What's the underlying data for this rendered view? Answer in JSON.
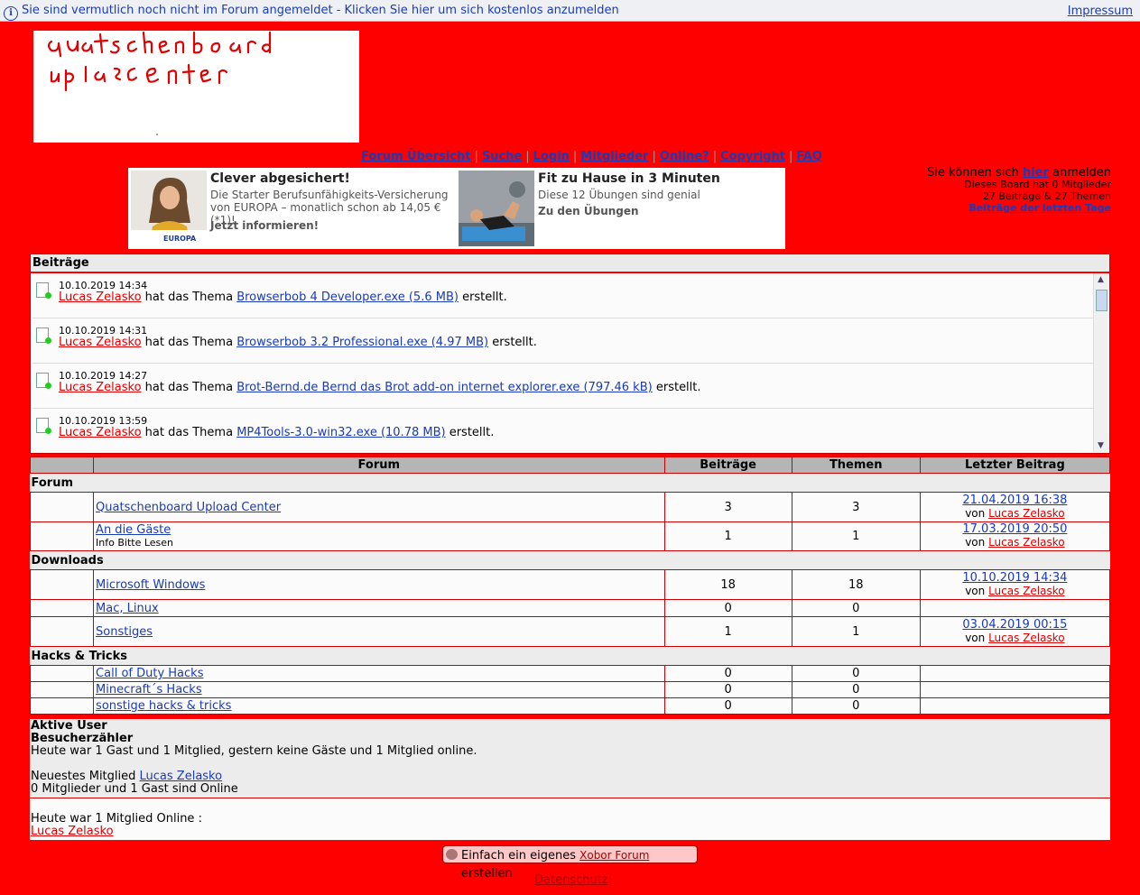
{
  "topbar": {
    "message": "Sie sind vermutlich noch nicht im Forum angemeldet - Klicken Sie hier um sich kostenlos anzumelden",
    "impressum": "Impressum"
  },
  "nav": [
    "Forum Übersicht",
    "Suche",
    "Login",
    "Mitglieder",
    "Online?",
    "Copyright",
    "FAQ"
  ],
  "ads": [
    {
      "title": "Clever abgesichert!",
      "desc": "Die Starter Berufsunfähigkeits-Versicherung von EUROPA – monatlich schon ab 14,05 € (*1)!",
      "cta": "Jetzt informieren!",
      "brand": "EUROPA"
    },
    {
      "title": "Fit zu Hause in 3 Minuten",
      "desc": "Diese 12 Übungen sind genial",
      "cta": "Zu den Übungen"
    }
  ],
  "login_box": {
    "pre": "Sie können sich ",
    "link": "hier",
    "post": " anmelden",
    "members": "Dieses Board hat 0 Mitglieder",
    "counts": "27 Beiträge & 27 Themen",
    "recent": "Beiträge der letzten Tage"
  },
  "feed": {
    "header": "Beiträge",
    "mid": " hat das Thema ",
    "end": " erstellt.",
    "items": [
      {
        "time": "10.10.2019 14:34",
        "user": "Lucas Zelasko",
        "topic": "Browserbob 4 Developer.exe (5.6 MB)"
      },
      {
        "time": "10.10.2019 14:31",
        "user": "Lucas Zelasko",
        "topic": "Browserbob 3.2 Professional.exe (4.97 MB)"
      },
      {
        "time": "10.10.2019 14:27",
        "user": "Lucas Zelasko",
        "topic": "Brot-Bernd.de Bernd das Brot add-on internet explorer.exe (797.46 kB)"
      },
      {
        "time": "10.10.2019 13:59",
        "user": "Lucas Zelasko",
        "topic": "MP4Tools-3.0-win32.exe (10.78 MB)"
      }
    ]
  },
  "table": {
    "headers": [
      "Forum",
      "Beiträge",
      "Themen",
      "Letzter Beitrag"
    ],
    "von": "von ",
    "categories": [
      {
        "name": "Forum",
        "rows": [
          {
            "title": "Quatschenboard Upload Center",
            "sub": "",
            "posts": "3",
            "topics": "3",
            "date": "21.04.2019 16:38",
            "user": "Lucas Zelasko"
          },
          {
            "title": "An die Gäste",
            "sub": "Info Bitte Lesen",
            "posts": "1",
            "topics": "1",
            "date": "17.03.2019 20:50",
            "user": "Lucas Zelasko"
          }
        ]
      },
      {
        "name": "Downloads",
        "rows": [
          {
            "title": "Microsoft Windows",
            "sub": "",
            "posts": "18",
            "topics": "18",
            "date": "10.10.2019 14:34",
            "user": "Lucas Zelasko"
          },
          {
            "title": "Mac, Linux",
            "sub": "",
            "posts": "0",
            "topics": "0",
            "date": "",
            "user": ""
          },
          {
            "title": "Sonstiges",
            "sub": "",
            "posts": "1",
            "topics": "1",
            "date": "03.04.2019 00:15",
            "user": "Lucas Zelasko"
          }
        ]
      },
      {
        "name": "Hacks & Tricks",
        "rows": [
          {
            "title": "Call of Duty Hacks",
            "sub": "",
            "posts": "0",
            "topics": "0",
            "date": "",
            "user": ""
          },
          {
            "title": "Minecraft´s Hacks",
            "sub": "",
            "posts": "0",
            "topics": "0",
            "date": "",
            "user": ""
          },
          {
            "title": "sonstige hacks & tricks",
            "sub": "",
            "posts": "0",
            "topics": "0",
            "date": "",
            "user": ""
          }
        ]
      }
    ]
  },
  "stats": {
    "active": "Aktive User",
    "counter": "Besucherzähler",
    "today": "Heute war 1 Gast und 1 Mitglied, gestern keine Gäste und 1 Mitglied online.",
    "newest_label": "Neuestes Mitglied ",
    "newest": "Lucas Zelasko",
    "online": "0 Mitglieder und 1 Gast sind Online",
    "today_members": "Heute war 1 Mitglied Online :",
    "today_user": "Lucas Zelasko"
  },
  "footer": {
    "pre": "Einfach ein eigenes ",
    "link": "Xobor Forum",
    "post": " erstellen",
    "datenschutz": "Datenschutz"
  },
  "colors": {
    "background": "#ff0000",
    "link": "#1a3bb5",
    "user_link": "#dd0000"
  }
}
